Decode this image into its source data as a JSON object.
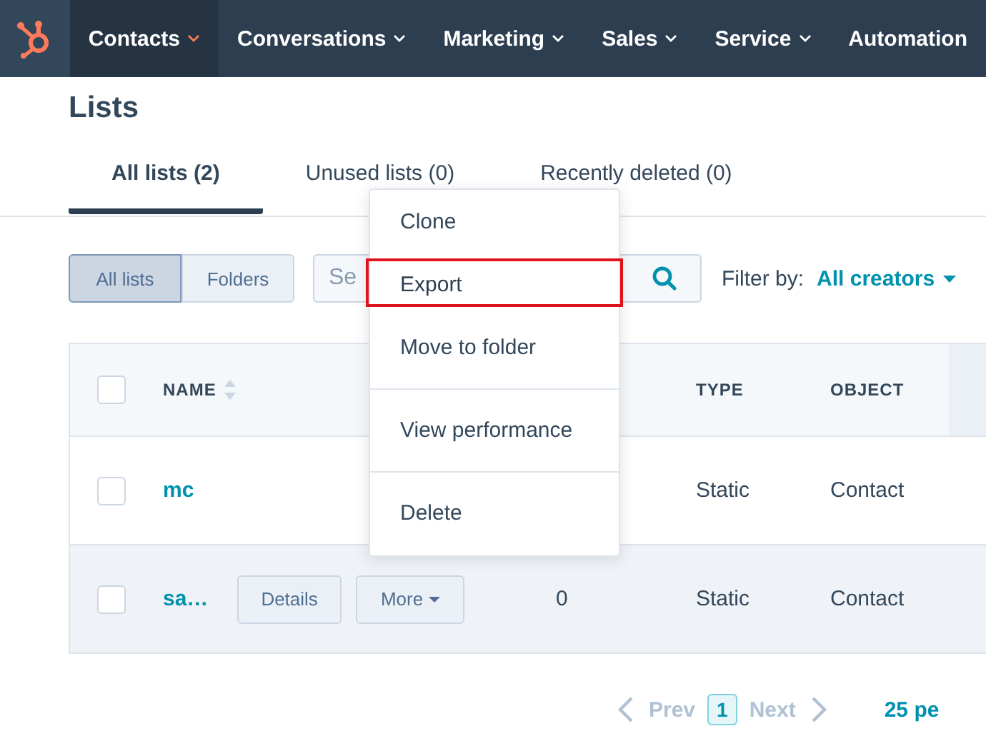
{
  "nav": {
    "items": [
      {
        "label": "Contacts",
        "selected": true
      },
      {
        "label": "Conversations",
        "selected": false
      },
      {
        "label": "Marketing",
        "selected": false
      },
      {
        "label": "Sales",
        "selected": false
      },
      {
        "label": "Service",
        "selected": false
      },
      {
        "label": "Automation",
        "selected": false
      }
    ]
  },
  "page_title": "Lists",
  "tabs": [
    {
      "label": "All lists (2)",
      "selected": true
    },
    {
      "label": "Unused lists (0)",
      "selected": false
    },
    {
      "label": "Recently deleted (0)",
      "selected": false
    }
  ],
  "view_toggle": [
    {
      "label": "All lists",
      "selected": true
    },
    {
      "label": "Folders",
      "selected": false
    }
  ],
  "search": {
    "placeholder": "Se"
  },
  "filter": {
    "label": "Filter by:",
    "value": "All creators"
  },
  "table": {
    "select_all_checked": false,
    "name_header": "NAME",
    "type_header": "TYPE",
    "object_header": "OBJECT",
    "rows": [
      {
        "name": "mc",
        "checked": false,
        "hovered": false,
        "type": "Static",
        "object": "Contact"
      },
      {
        "name": "sa…",
        "checked": false,
        "hovered": true,
        "actions": [
          "Details",
          "More"
        ],
        "count": "0",
        "type": "Static",
        "object": "Contact"
      }
    ]
  },
  "menu": {
    "items": [
      {
        "label": "Clone",
        "highlighted": false,
        "divider_before": false
      },
      {
        "label": "Export",
        "highlighted": true,
        "divider_before": false
      },
      {
        "label": "Move to folder",
        "highlighted": false,
        "divider_before": false
      },
      {
        "label": "View performance",
        "highlighted": false,
        "divider_before": true
      },
      {
        "label": "Delete",
        "highlighted": false,
        "divider_before": true
      }
    ]
  },
  "pagination": {
    "prev": "Prev",
    "page": "1",
    "next": "Next",
    "per_page": "25 pe"
  }
}
